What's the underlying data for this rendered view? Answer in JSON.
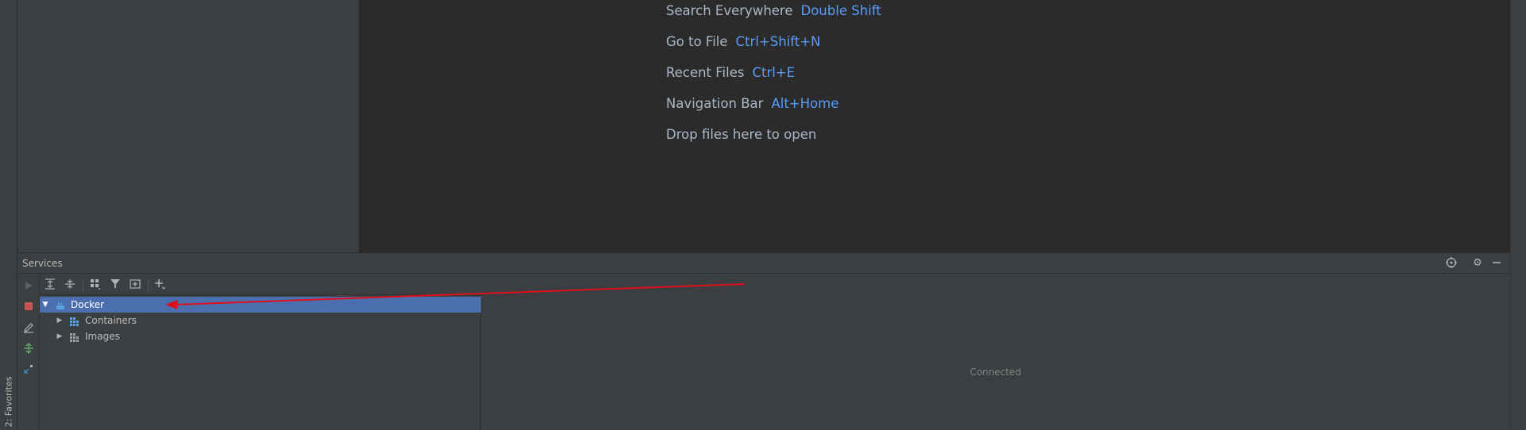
{
  "favorites_tab": "2: Favorites",
  "editor_hints": [
    {
      "label": "Search Everywhere",
      "key": "Double Shift"
    },
    {
      "label": "Go to File",
      "key": "Ctrl+Shift+N"
    },
    {
      "label": "Recent Files",
      "key": "Ctrl+E"
    },
    {
      "label": "Navigation Bar",
      "key": "Alt+Home"
    },
    {
      "label": "Drop files here to open",
      "key": ""
    }
  ],
  "services": {
    "title": "Services",
    "header_icons": [
      "crosshair-icon",
      "gear-icon",
      "minimize-icon"
    ],
    "side_toolbar": [
      "run-icon",
      "stop-icon",
      "edit-icon",
      "deploy-icon",
      "expand-icon"
    ],
    "tree_toolbar": [
      "expand-all-icon",
      "collapse-all-icon",
      "group-icon",
      "filter-icon",
      "new-tab-icon",
      "add-icon"
    ],
    "tree": [
      {
        "label": "Docker",
        "expanded": true,
        "selected": true,
        "icon": "docker-icon"
      },
      {
        "label": "Containers",
        "expanded": false,
        "selected": false,
        "icon": "containers-icon"
      },
      {
        "label": "Images",
        "expanded": false,
        "selected": false,
        "icon": "images-icon"
      }
    ],
    "status": "Connected"
  },
  "colors": {
    "accent_selection": "#4b6eaf",
    "shortcut_blue": "#589df6",
    "stop_red": "#c75450",
    "annotation_red": "#e0101a"
  }
}
